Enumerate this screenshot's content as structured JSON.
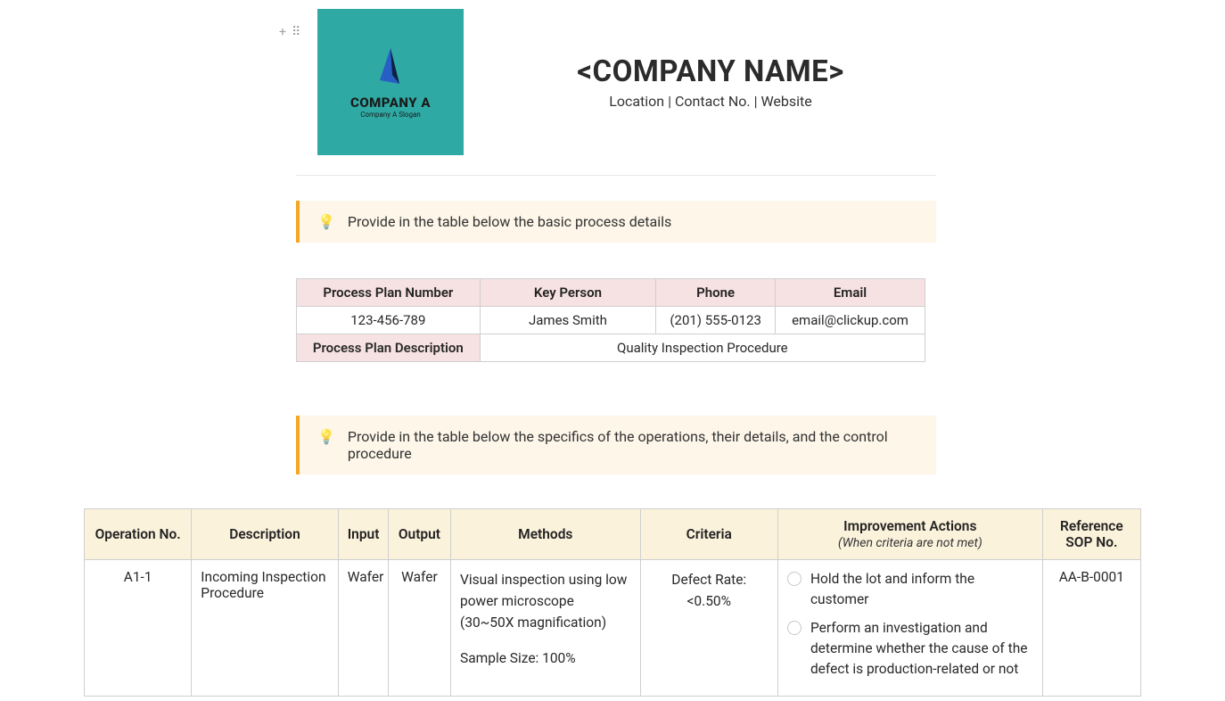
{
  "logo": {
    "name": "COMPANY A",
    "slogan": "Company A Slogan"
  },
  "header": {
    "company_name": "<COMPANY NAME>",
    "subtitle": "Location | Contact No. | Website"
  },
  "callouts": {
    "c1_icon": "💡",
    "c1_text": "Provide in the table below the basic process details",
    "c2_icon": "💡",
    "c2_text": "Provide in the table below the specifics of the operations, their details, and the control procedure"
  },
  "process_table": {
    "headers": {
      "plan_number": "Process Plan Number",
      "key_person": "Key Person",
      "phone": "Phone",
      "email": "Email",
      "plan_desc_label": "Process Plan Description"
    },
    "values": {
      "plan_number": "123-456-789",
      "key_person": "James Smith",
      "phone": "(201) 555-0123",
      "email": "email@clickup.com",
      "plan_desc": "Quality Inspection Procedure"
    }
  },
  "ops_table": {
    "headers": {
      "op_no": "Operation No.",
      "desc": "Description",
      "input": "Input",
      "output": "Output",
      "methods": "Methods",
      "criteria": "Criteria",
      "improvement": "Improvement Actions",
      "improvement_sub": "(When criteria are not met)",
      "reference": "Reference SOP No."
    },
    "rows": [
      {
        "op_no": "A1-1",
        "desc": "Incoming Inspection Procedure",
        "input": "Wafer",
        "output": "Wafer",
        "methods_line1": "Visual inspection using low power microscope (30~50X magnification)",
        "methods_line2": "Sample Size: 100%",
        "criteria_line1": "Defect Rate:",
        "criteria_line2": "<0.50%",
        "action1": "Hold the lot and inform the customer",
        "action2": "Perform an investigation and determine whether the cause of the defect is production-related or not",
        "reference": "AA-B-0001"
      }
    ]
  }
}
